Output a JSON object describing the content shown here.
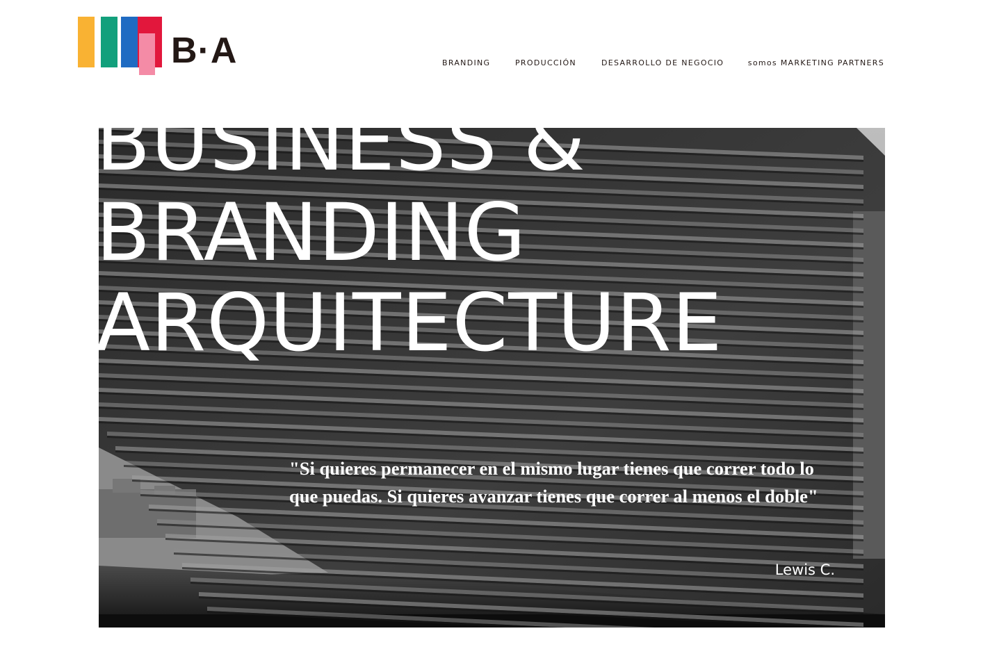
{
  "brand": {
    "logo_text": "B·A",
    "colors": {
      "yellow": "#F9B233",
      "green": "#12A07C",
      "blue": "#1F6BC2",
      "red": "#E2173C",
      "pink": "#F48BA6",
      "text": "#231815"
    }
  },
  "nav": {
    "items": [
      {
        "label": "BRANDING"
      },
      {
        "label": "PRODUCCIÓN"
      },
      {
        "label": "DESARROLLO DE NEGOCIO"
      },
      {
        "label": "somos MARKETING PARTNERS"
      }
    ]
  },
  "hero": {
    "headline": [
      "BUSINESS &",
      "BRANDING",
      "ARQUITECTURE"
    ],
    "quote": "\"Si quieres permanecer en el mismo lugar tienes que correr todo lo que puedas. Si quieres avanzar tienes que correr al menos el doble\"",
    "author": "Lewis C.",
    "image": "black-and-white architectural facade with horizontal louvers"
  }
}
